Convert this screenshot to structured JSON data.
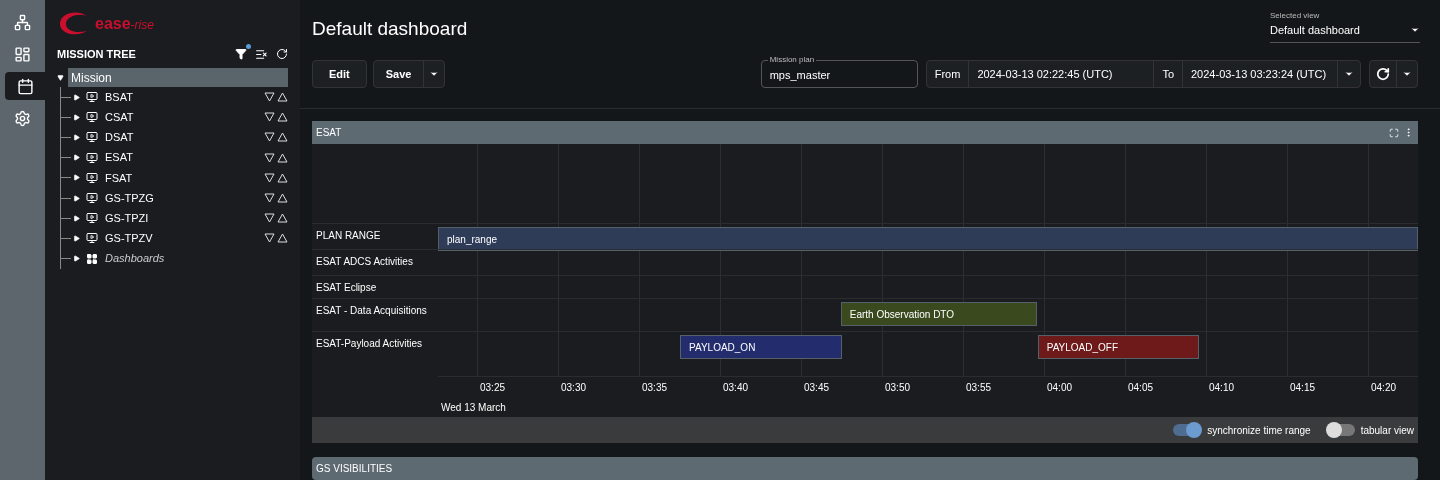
{
  "nav_rail": {
    "items": [
      {
        "kind": "tree",
        "selected": false
      },
      {
        "kind": "dashboard",
        "selected": false
      },
      {
        "kind": "calendar",
        "selected": true
      },
      {
        "kind": "settings",
        "selected": false
      }
    ]
  },
  "sidebar": {
    "logo": {
      "name": "ease",
      "suffix": "-rise"
    },
    "title": "MISSION TREE",
    "filter_active": true,
    "tree": {
      "label": "Mission",
      "expanded": true,
      "selected": true,
      "children": [
        {
          "label": "BSAT",
          "kind": "asset",
          "expanded": false
        },
        {
          "label": "CSAT",
          "kind": "asset",
          "expanded": false
        },
        {
          "label": "DSAT",
          "kind": "asset",
          "expanded": false
        },
        {
          "label": "ESAT",
          "kind": "asset",
          "expanded": false
        },
        {
          "label": "FSAT",
          "kind": "asset",
          "expanded": false
        },
        {
          "label": "GS-TPZG",
          "kind": "asset",
          "expanded": false
        },
        {
          "label": "GS-TPZI",
          "kind": "asset",
          "expanded": false
        },
        {
          "label": "GS-TPZV",
          "kind": "asset",
          "expanded": false
        },
        {
          "label": "Dashboards",
          "kind": "dashboards",
          "expanded": false
        }
      ]
    }
  },
  "header": {
    "title": "Default dashboard",
    "selected_view": {
      "label": "Selected view",
      "value": "Default dashboard"
    }
  },
  "toolbar": {
    "buttons": [
      "Edit",
      "Save"
    ],
    "mission_plan": {
      "label": "Mission plan",
      "value": "mps_master"
    },
    "from_label": "From",
    "from_value": "2024-03-13 02:22:45 (UTC)",
    "to_label": "To",
    "to_value": "2024-03-13 03:23:24 (UTC)"
  },
  "panels": [
    {
      "title": "ESAT",
      "rows": [
        {
          "label": "PLAN RANGE",
          "bars": [
            {
              "text": "plan_range",
              "color": "#2e3c58"
            }
          ]
        },
        {
          "label": "ESAT ADCS Activities",
          "bars": []
        },
        {
          "label": "ESAT Eclipse",
          "bars": []
        },
        {
          "label": "ESAT - Data Acquisitions",
          "bars": [
            {
              "text": "Earth Observation DTO",
              "color": "#3a4a1e"
            }
          ]
        },
        {
          "label": "ESAT-Payload Activities",
          "bars": [
            {
              "text": "PAYLOAD_ON",
              "color": "#232d6e"
            },
            {
              "text": "PAYLOAD_OFF",
              "color": "#6e1a1a"
            }
          ]
        }
      ],
      "xticks": [
        "03:25",
        "03:30",
        "03:35",
        "03:40",
        "03:45",
        "03:50",
        "03:55",
        "04:00",
        "04:05",
        "04:10",
        "04:15",
        "04:20"
      ],
      "date": "Wed 13 March",
      "toggles": [
        {
          "label": "synchronize time range",
          "on": true
        },
        {
          "label": "tabular view",
          "on": false
        }
      ]
    },
    {
      "title": "GS VISIBILITIES"
    }
  ]
}
